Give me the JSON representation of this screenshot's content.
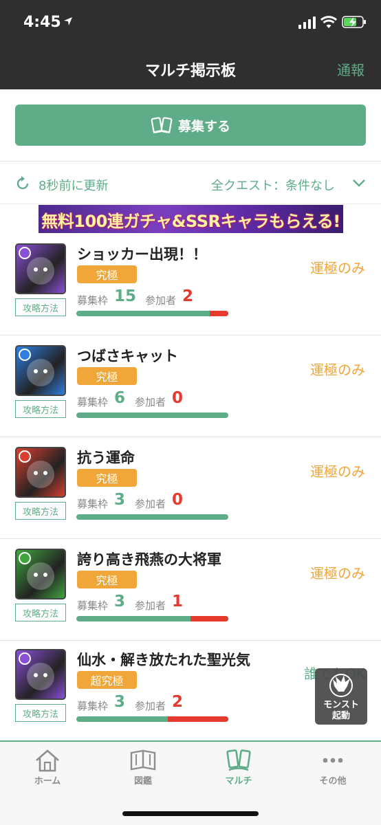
{
  "status": {
    "time": "4:45"
  },
  "header": {
    "title": "マルチ掲示板",
    "report": "通報"
  },
  "recruit": {
    "label": "募集する"
  },
  "filter": {
    "updated": "8秒前に更新",
    "quest_filter": "全クエスト：条件なし"
  },
  "banner": {
    "text": "無料100連ガチャ&SSRキャラもらえる!"
  },
  "labels": {
    "how_to": "攻略方法",
    "capacity": "募集枠",
    "participants": "参加者"
  },
  "quests": [
    {
      "title": "ショッカー出現！！",
      "badge": "究極",
      "capacity": "15",
      "participants": "2",
      "condition": "運極のみ",
      "element_color": "#8a4fd8",
      "fill_ratio": 0.12
    },
    {
      "title": "つばさキャット",
      "badge": "究極",
      "capacity": "6",
      "participants": "0",
      "condition": "運極のみ",
      "element_color": "#2f7fe0",
      "fill_ratio": 0
    },
    {
      "title": "抗う運命",
      "badge": "究極",
      "capacity": "3",
      "participants": "0",
      "condition": "運極のみ",
      "element_color": "#d8402f",
      "fill_ratio": 0
    },
    {
      "title": "誇り高き飛燕の大将軍",
      "badge": "究極",
      "capacity": "3",
      "participants": "1",
      "condition": "運極のみ",
      "element_color": "#3fa63f",
      "fill_ratio": 0.25
    },
    {
      "title": "仙水・解き放たれた聖光気",
      "badge": "超究極",
      "capacity": "3",
      "participants": "2",
      "condition": "誰でもOK",
      "element_color": "#8a4fd8",
      "fill_ratio": 0.4
    }
  ],
  "launch": {
    "line1": "モンスト",
    "line2": "起動"
  },
  "tabs": [
    {
      "label": "ホーム",
      "icon": "home-icon"
    },
    {
      "label": "図鑑",
      "icon": "book-icon"
    },
    {
      "label": "マルチ",
      "icon": "cards-icon"
    },
    {
      "label": "その他",
      "icon": "more-icon"
    }
  ],
  "colors": {
    "accent": "#5fad88",
    "orange": "#f0a638",
    "red": "#e63a2e",
    "header": "#2f2f2f"
  }
}
